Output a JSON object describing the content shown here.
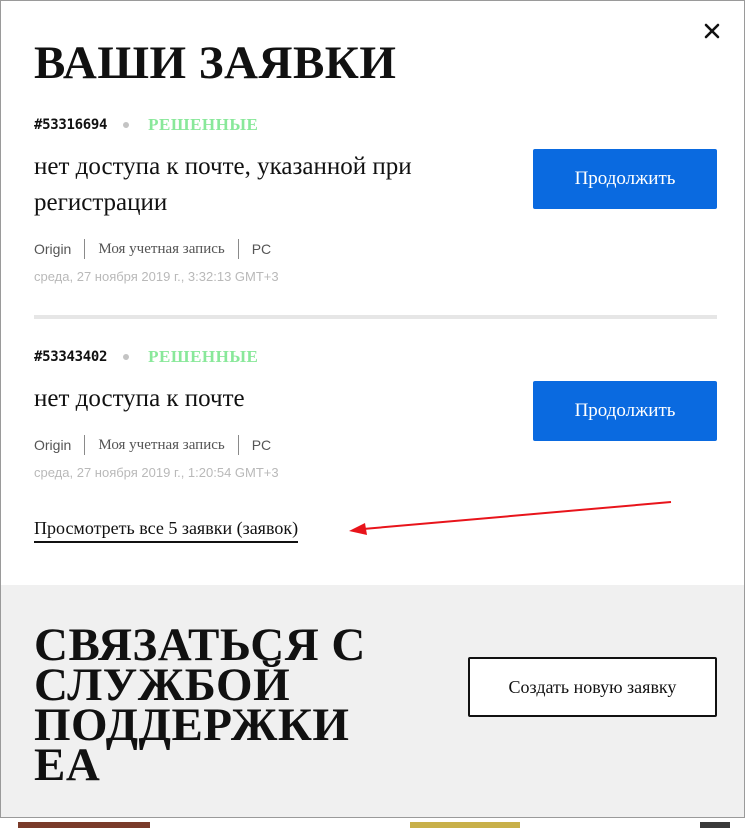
{
  "modal": {
    "title": "ВАШИ ЗАЯВКИ",
    "close_icon": "close-icon"
  },
  "tickets": [
    {
      "id": "#53316694",
      "status": "РЕШЕННЫЕ",
      "subject": "нет доступа к почте, указанной при регистрации",
      "tags": [
        "Origin",
        "Моя учетная запись",
        "PC"
      ],
      "date": "среда, 27 ноября 2019 г., 3:32:13 GMT+3",
      "button_label": "Продолжить"
    },
    {
      "id": "#53343402",
      "status": "РЕШЕННЫЕ",
      "subject": "нет доступа к почте",
      "tags": [
        "Origin",
        "Моя учетная запись",
        "PC"
      ],
      "date": "среда, 27 ноября 2019 г., 1:20:54 GMT+3",
      "button_label": "Продолжить"
    }
  ],
  "view_all_label": "Просмотреть все 5 заявки (заявок)",
  "support": {
    "title": "СВЯЗАТЬСЯ С СЛУЖБОЙ ПОДДЕРЖКИ EA",
    "new_request_label": "Создать новую заявку"
  },
  "colors": {
    "accent_blue": "#0a6ae0",
    "status_green": "#89e89a",
    "annotation_red": "#e8141b",
    "support_bg": "#f0f0f0"
  }
}
